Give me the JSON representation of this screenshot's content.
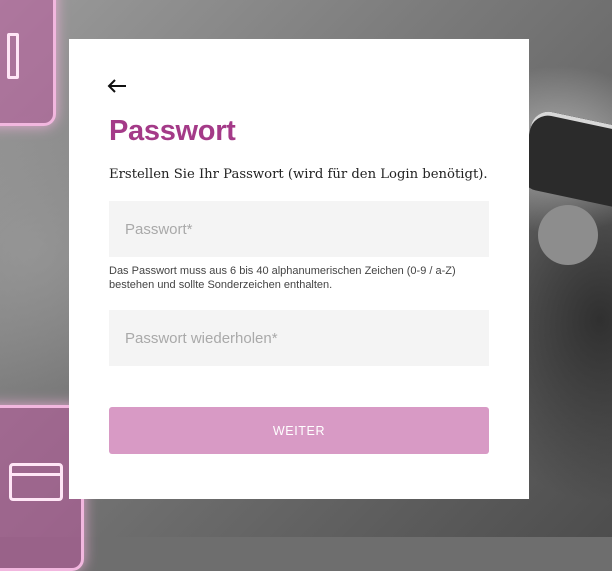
{
  "page": {
    "title": "Passwort",
    "subtitle": "Erstellen Sie Ihr Passwort (wird für den Login benötigt).",
    "password_field": {
      "placeholder": "Passwort*",
      "value": ""
    },
    "password_hint": "Das Passwort muss aus 6 bis 40 alphanumerischen Zeichen (0-9 / a-Z) bestehen und sollte Sonderzeichen enthalten.",
    "repeat_field": {
      "placeholder": "Passwort wiederholen*",
      "value": ""
    },
    "submit_label": "WEITER"
  },
  "icons": {
    "back": "arrow-left-icon"
  },
  "colors": {
    "accent": "#a43a88",
    "button": "#d89ac5",
    "field_bg": "#f4f4f4",
    "card_bg": "#ffffff"
  }
}
